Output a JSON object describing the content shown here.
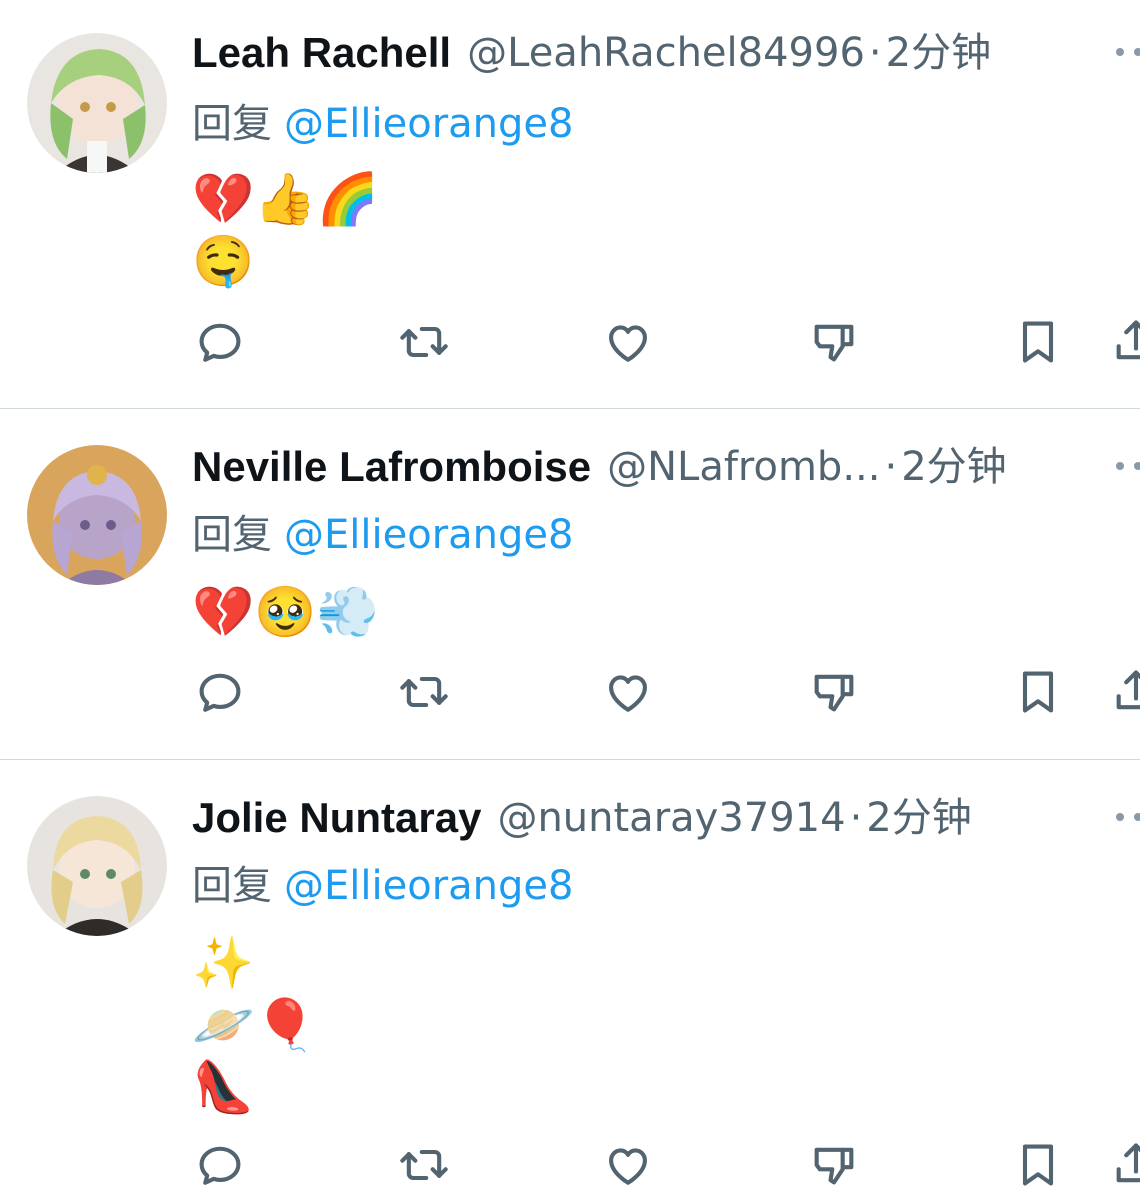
{
  "tweets": [
    {
      "name": "Leah Rachell",
      "handle": "@LeahRachel84996",
      "separator": "·",
      "time": "2分钟",
      "reply_prefix": "回复",
      "reply_to": "@Ellieorange8",
      "content_lines": [
        "💔👍🌈",
        "🤤"
      ]
    },
    {
      "name": "Neville Lafromboise",
      "handle": "@NLafromb...",
      "separator": "·",
      "time": "2分钟",
      "reply_prefix": "回复",
      "reply_to": "@Ellieorange8",
      "content_lines": [
        "💔🥹💨"
      ]
    },
    {
      "name": "Jolie Nuntaray",
      "handle": "@nuntaray37914",
      "separator": "·",
      "time": "2分钟",
      "reply_prefix": "回复",
      "reply_to": "@Ellieorange8",
      "content_lines": [
        "✨",
        "🪐🎈",
        "👠"
      ]
    }
  ],
  "actions": [
    "reply-icon",
    "retweet-icon",
    "like-icon",
    "dislike-icon",
    "bookmark-icon",
    "share-icon"
  ],
  "colors": {
    "text": "#0f1419",
    "secondary": "#536471",
    "link": "#1d9bf0",
    "divider": "#cfd9de"
  }
}
